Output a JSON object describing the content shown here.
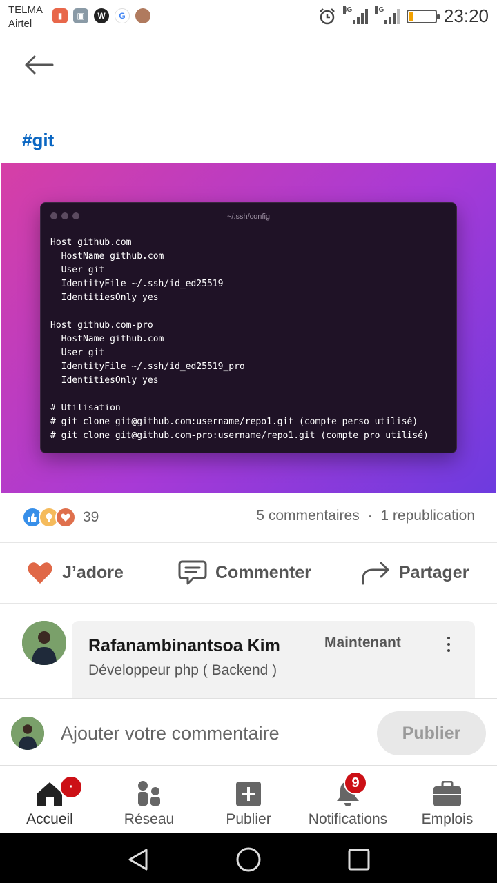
{
  "status_bar": {
    "carrier_line1": "TELMA",
    "carrier_line2": "Airtel",
    "network1": "4G",
    "network2": "3G",
    "time": "23:20",
    "battery_level": 0.15
  },
  "post": {
    "hashtag": "#git",
    "code_window": {
      "title": "~/.ssh/config",
      "lines": [
        "Host github.com",
        "  HostName github.com",
        "  User git",
        "  IdentityFile ~/.ssh/id_ed25519",
        "  IdentitiesOnly yes",
        "",
        "Host github.com-pro",
        "  HostName github.com",
        "  User git",
        "  IdentityFile ~/.ssh/id_ed25519_pro",
        "  IdentitiesOnly yes",
        "",
        "# Utilisation",
        "# git clone git@github.com:username/repo1.git (compte perso utilisé)",
        "# git clone git@github.com-pro:username/repo1.git (compte pro utilisé)"
      ]
    },
    "reaction_count": "39",
    "comments_count": "5 commentaires",
    "separator": "·",
    "reposts_count": "1 republication"
  },
  "actions": {
    "like": "J’adore",
    "comment": "Commenter",
    "share": "Partager"
  },
  "comment": {
    "author": "Rafanambinantsoa Kim",
    "time": "Maintenant",
    "headline": "Développeur php ( Backend )"
  },
  "comment_bar": {
    "placeholder": "Ajouter votre commentaire",
    "publish": "Publier"
  },
  "bottom_nav": {
    "home": "Accueil",
    "home_badge": "·",
    "network": "Réseau",
    "post": "Publier",
    "notifications": "Notifications",
    "notifications_badge": "9",
    "jobs": "Emplois"
  },
  "colors": {
    "brand": "#0a66c2",
    "badge": "#cc1016",
    "like_heart": "#e06847"
  }
}
